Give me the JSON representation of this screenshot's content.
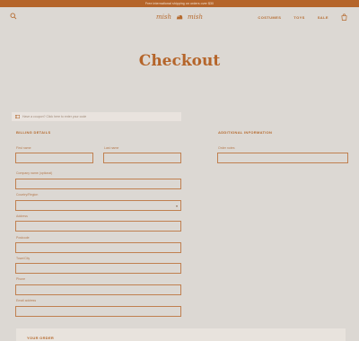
{
  "announcement": "Free international shipping on orders over $30",
  "header": {
    "logo_left": "mish",
    "logo_right": "mish",
    "nav": [
      "COSTUMES",
      "TOYS",
      "SALE"
    ]
  },
  "page": {
    "title": "Checkout"
  },
  "coupon": {
    "text": "Have a coupon? Click here to enter your code"
  },
  "billing": {
    "heading": "BILLING DETAILS",
    "first_name": "First name",
    "last_name": "Last name",
    "company": "Company name (optional)",
    "country": "Country/Region",
    "address": "Address",
    "postcode": "Postcode",
    "town": "Town/City",
    "phone": "Phone",
    "email": "Email address"
  },
  "additional": {
    "heading": "ADDITIONAL INFORMATION",
    "order_notes": "Order notes"
  },
  "order": {
    "heading": "YOUR ORDER"
  },
  "colors": {
    "accent": "#b5652a",
    "background": "#dcd8d3",
    "panel": "#e8e3dd"
  }
}
